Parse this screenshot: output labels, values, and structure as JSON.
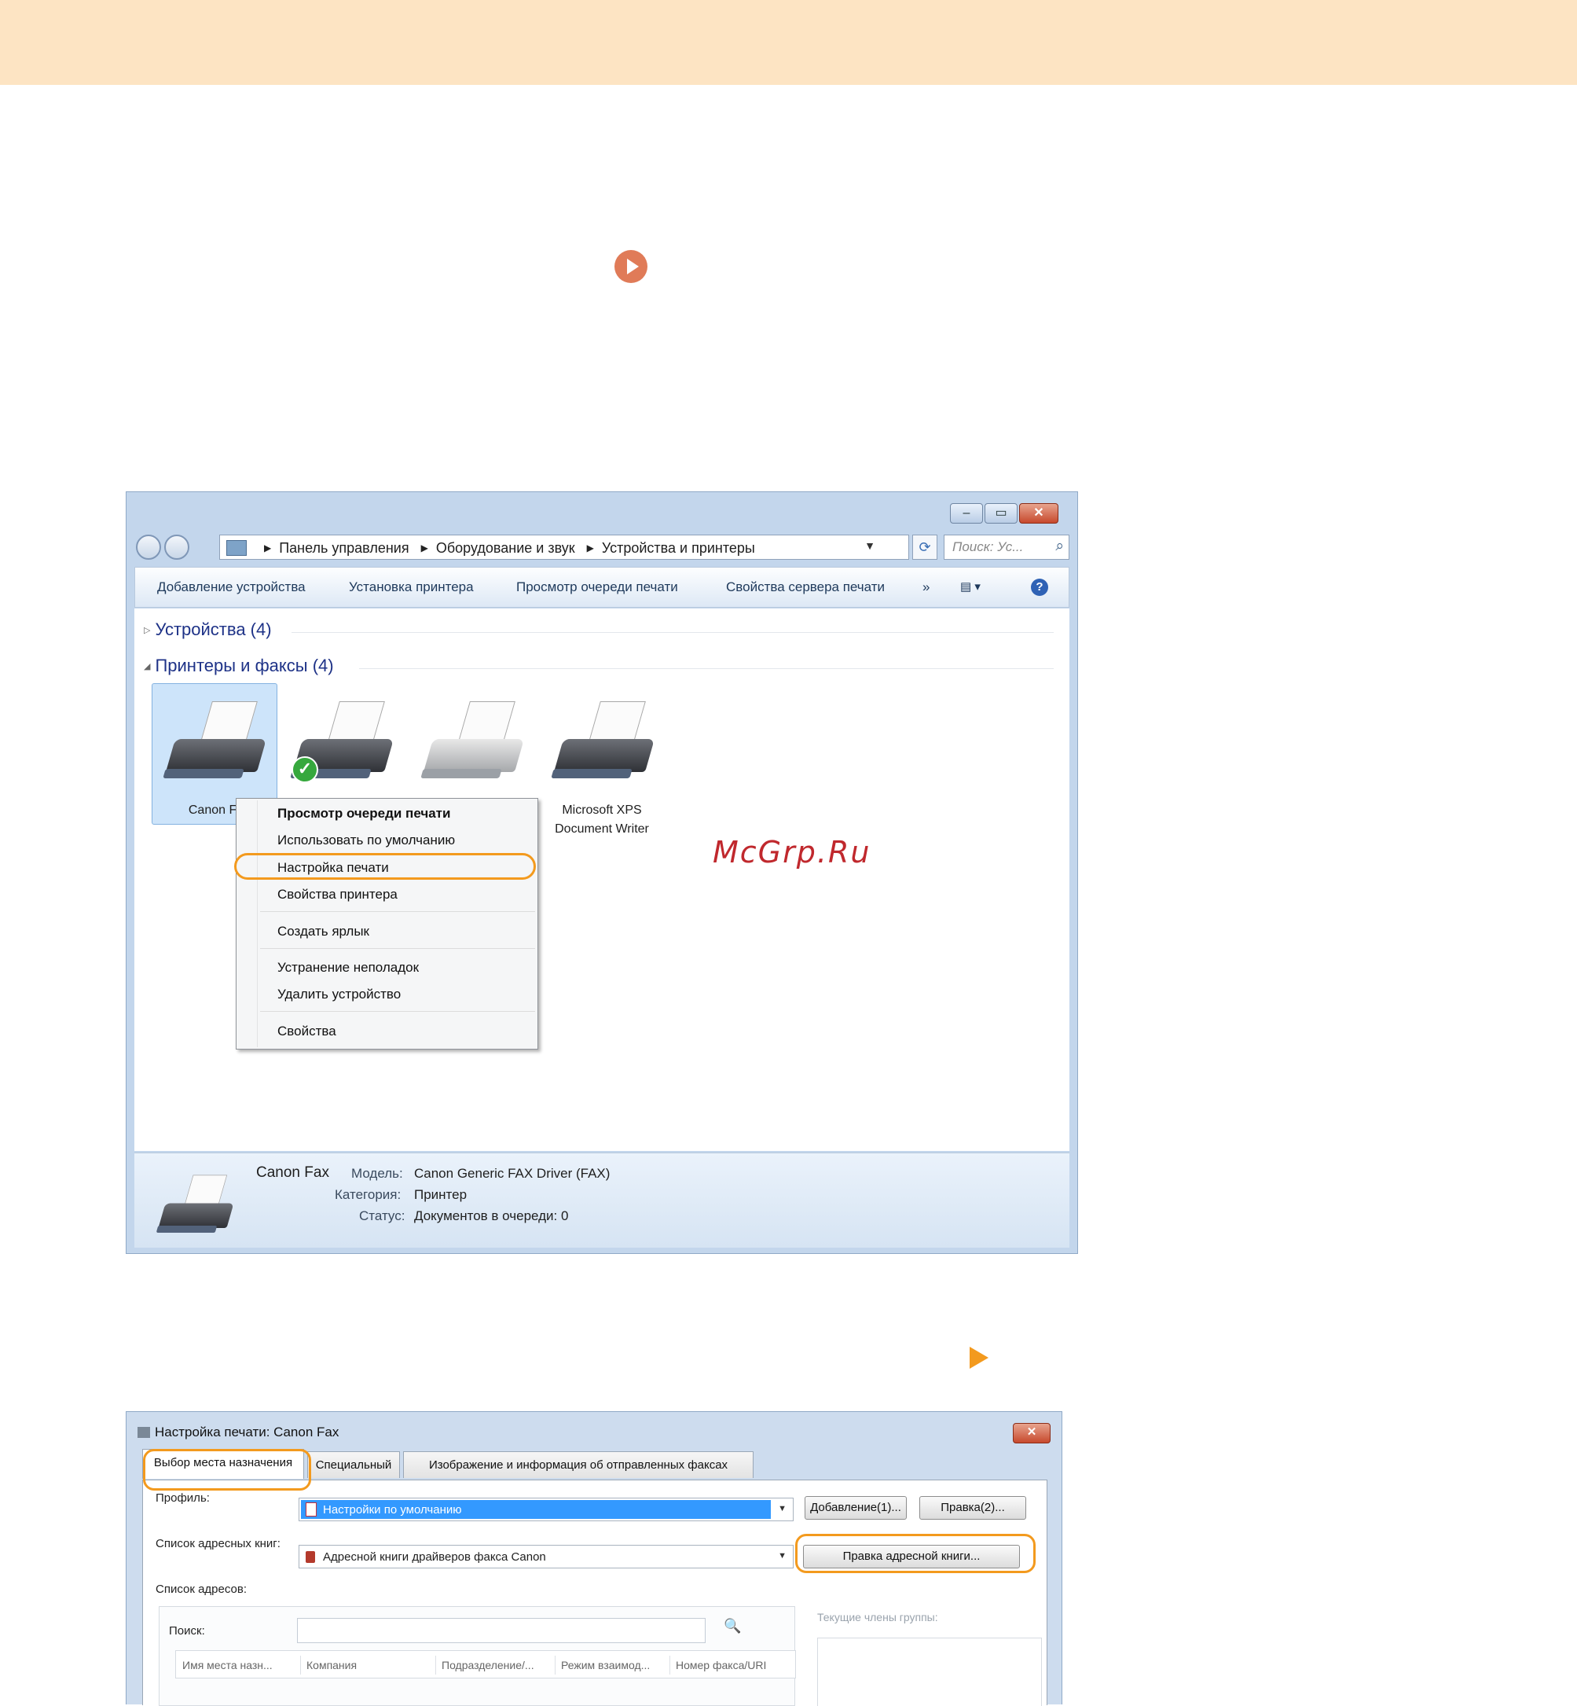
{
  "markers": {
    "play_icon_color": "#e07b58",
    "arrow_icon_color": "#f39a1e",
    "highlight_color": "#f39a1e"
  },
  "watermark": "McGrp.Ru",
  "explorer": {
    "address": [
      "Панель управления",
      "Оборудование и звук",
      "Устройства и принтеры"
    ],
    "search_placeholder": "Поиск: Ус...",
    "toolbar": [
      "Добавление устройства",
      "Установка принтера",
      "Просмотр очереди печати",
      "Свойства сервера печати",
      "»"
    ],
    "groups": {
      "devices": "Устройства (4)",
      "printers": "Принтеры и факсы (4)"
    },
    "printers": [
      {
        "label": "Canon Fa"
      },
      {
        "label": ""
      },
      {
        "label": ""
      },
      {
        "label": "Microsoft XPS Document Writer"
      }
    ],
    "context_menu": [
      "Просмотр очереди печати",
      "Использовать по умолчанию",
      "Настройка печати",
      "Свойства принтера",
      "Создать ярлык",
      "Устранение неполадок",
      "Удалить устройство",
      "Свойства"
    ],
    "details": {
      "name": "Canon Fax",
      "model_label": "Модель:",
      "model_value": "Canon Generic FAX Driver (FAX)",
      "category_label": "Категория:",
      "category_value": "Принтер",
      "status_label": "Статус:",
      "status_value": "Документов в очереди: 0"
    }
  },
  "print_dialog": {
    "title": "Настройка печати: Canon Fax",
    "tabs": [
      "Выбор места назначения",
      "Специальный",
      "Изображение и информация об отправленных факсах"
    ],
    "profile_label": "Профиль:",
    "profile_value": "Настройки по умолчанию",
    "add_button": "Добавление(1)...",
    "edit_button": "Правка(2)...",
    "address_books_label": "Список адресных книг:",
    "address_book_value": "Адресной книги драйверов факса Canon",
    "edit_address_book_button": "Правка адресной книги...",
    "address_list_label": "Список адресов:",
    "search_label": "Поиск:",
    "columns": [
      "Имя места назн...",
      "Компания",
      "Подразделение/...",
      "Режим взаимод...",
      "Номер факса/URI"
    ],
    "group_members_label": "Текущие члены группы:"
  }
}
